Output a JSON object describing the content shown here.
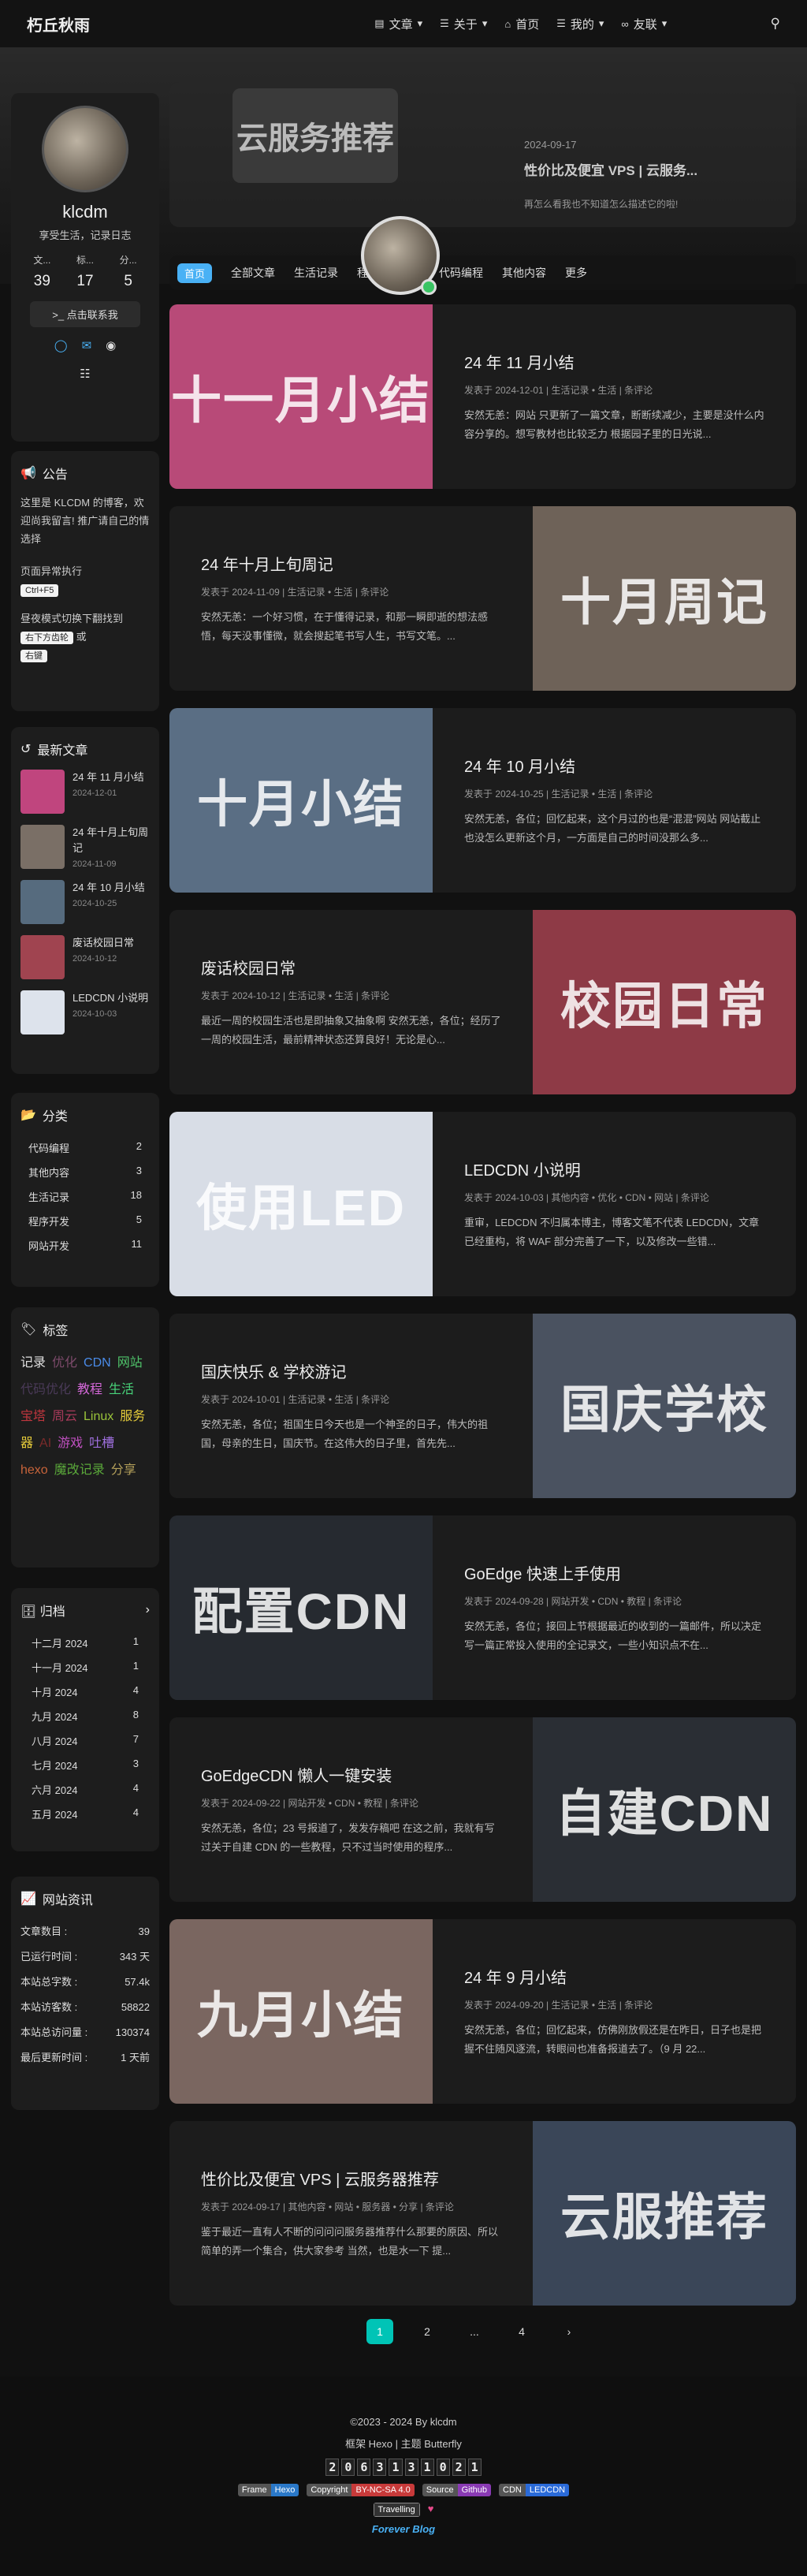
{
  "nav": {
    "brand": "朽丘秋雨",
    "menu": [
      {
        "icon": "▤",
        "label": "文章",
        "caret": true
      },
      {
        "icon": "☰",
        "label": "关于",
        "caret": true
      },
      {
        "icon": "⌂",
        "label": "首页",
        "caret": false
      },
      {
        "icon": "☰",
        "label": "我的",
        "caret": true
      },
      {
        "icon": "∞",
        "label": "友联",
        "caret": true
      }
    ],
    "search_icon": "search-icon"
  },
  "featured": {
    "thumb_text": "云服务推荐",
    "date": "2024-09-17",
    "title": "性价比及便宜 VPS | 云服务...",
    "excerpt": "再怎么看我也不知道怎么描述它的啦!"
  },
  "catbar": [
    "首页",
    "全部文章",
    "生活记录",
    "程序",
    "开发",
    "代码编程",
    "其他内容",
    "更多"
  ],
  "profile": {
    "name": "klcdm",
    "motto": "享受生活，记录日志",
    "stats": [
      {
        "k": "文...",
        "v": "39"
      },
      {
        "k": "标...",
        "v": "17"
      },
      {
        "k": "分...",
        "v": "5"
      }
    ],
    "contact": "点击联系我"
  },
  "announce": {
    "title": "公告",
    "text": "这里是 KLCDM 的博客，欢迎尚我留言! 推广请自己的情选择",
    "exec": "页面异常执行",
    "key": "Ctrl+F5",
    "tip1": "昼夜模式切换下翻找到",
    "key2": "右下方齿轮",
    "or": "或",
    "key3": "右键"
  },
  "recent": {
    "title": "最新文章",
    "items": [
      {
        "title": "24 年 11 月小结",
        "date": "2024-12-01",
        "color": "#c0457e"
      },
      {
        "title": "24 年十月上旬周记",
        "date": "2024-11-09",
        "color": "#7a6f66"
      },
      {
        "title": "24 年 10 月小结",
        "date": "2024-10-25",
        "color": "#566b7e"
      },
      {
        "title": "废话校园日常",
        "date": "2024-10-12",
        "color": "#a04450"
      },
      {
        "title": "LEDCDN 小说明",
        "date": "2024-10-03",
        "color": "#dde3ec"
      }
    ]
  },
  "categories": {
    "title": "分类",
    "items": [
      {
        "name": "代码编程",
        "count": "2"
      },
      {
        "name": "其他内容",
        "count": "3"
      },
      {
        "name": "生活记录",
        "count": "18"
      },
      {
        "name": "程序开发",
        "count": "5"
      },
      {
        "name": "网站开发",
        "count": "11"
      }
    ]
  },
  "tags": {
    "title": "标签",
    "items": [
      {
        "t": "记录",
        "c": "#e0e0e0"
      },
      {
        "t": "优化",
        "c": "#7c4a6a"
      },
      {
        "t": "CDN",
        "c": "#4a8be8"
      },
      {
        "t": "网站",
        "c": "#4fc36a"
      },
      {
        "t": "代码优化",
        "c": "#4a3a58"
      },
      {
        "t": "教程",
        "c": "#d468d8"
      },
      {
        "t": "生活",
        "c": "#48d47a"
      },
      {
        "t": "宝塔",
        "c": "#c0363e"
      },
      {
        "t": "周云",
        "c": "#a83a5a"
      },
      {
        "t": "Linux",
        "c": "#9ac43a"
      },
      {
        "t": "服务器",
        "c": "#e6cc3a"
      },
      {
        "t": "AI",
        "c": "#7a2a2a"
      },
      {
        "t": "游戏",
        "c": "#c050c0"
      },
      {
        "t": "吐槽",
        "c": "#a070e0"
      },
      {
        "t": "hexo",
        "c": "#c8643a"
      },
      {
        "t": "魔改记录",
        "c": "#5aa83a"
      },
      {
        "t": "分享",
        "c": "#b4a05a"
      }
    ]
  },
  "archive": {
    "title": "归档",
    "items": [
      {
        "m": "十二月 2024",
        "n": "1"
      },
      {
        "m": "十一月 2024",
        "n": "1"
      },
      {
        "m": "十月 2024",
        "n": "4"
      },
      {
        "m": "九月 2024",
        "n": "8"
      },
      {
        "m": "八月 2024",
        "n": "7"
      },
      {
        "m": "七月 2024",
        "n": "3"
      },
      {
        "m": "六月 2024",
        "n": "4"
      },
      {
        "m": "五月 2024",
        "n": "4"
      }
    ]
  },
  "siteinfo": {
    "title": "网站资讯",
    "rows": [
      {
        "k": "文章数目 :",
        "v": "39"
      },
      {
        "k": "已运行时间 :",
        "v": "343 天"
      },
      {
        "k": "本站总字数 :",
        "v": "57.4k"
      },
      {
        "k": "本站访客数 :",
        "v": "58822"
      },
      {
        "k": "本站总访问量 :",
        "v": "130374"
      },
      {
        "k": "最后更新时间 :",
        "v": "1 天前"
      }
    ]
  },
  "posts": [
    {
      "title": "24 年 11 月小结",
      "meta": "发表于 2024-12-01 | 生活记录 • 生活 | 条评论",
      "excerpt": "安然无恙：网站 只更新了一篇文章，断断续减少，主要是没什么内容分享的。想写教材也比较乏力 根据园子里的日光说...",
      "thumb": "十一月小结",
      "color": "#b84a78",
      "side": "left"
    },
    {
      "title": "24 年十月上旬周记",
      "meta": "发表于 2024-11-09 | 生活记录 • 生活 | 条评论",
      "excerpt": "安然无恙：一个好习惯，在于懂得记录，和那一瞬即逝的想法感悟，每天没事懂微，就会搜起笔书写人生，书写文笔。...",
      "thumb": "十月周记",
      "color": "#6e6258",
      "side": "right"
    },
    {
      "title": "24 年 10 月小结",
      "meta": "发表于 2024-10-25 | 生活记录 • 生活 | 条评论",
      "excerpt": "安然无恙，各位；回忆起来，这个月过的也是“混混”网站 网站截止也没怎么更新这个月，一方面是自己的时间没那么多...",
      "thumb": "十月小结",
      "color": "#5a6e84",
      "side": "left"
    },
    {
      "title": "废话校园日常",
      "meta": "发表于 2024-10-12 | 生活记录 • 生活 | 条评论",
      "excerpt": "最近一周的校园生活也是即抽象又抽象啊 安然无恙，各位；经历了一周的校园生活，最前精神状态还算良好！无论是心...",
      "thumb": "校园日常",
      "color": "#8e3a46",
      "side": "right"
    },
    {
      "title": "LEDCDN 小说明",
      "meta": "发表于 2024-10-03 | 其他内容 • 优化 • CDN • 网站 | 条评论",
      "excerpt": "重审，LEDCDN 不归属本博主，博客文笔不代表 LEDCDN，文章已经重构，将 WAF 部分完善了一下，以及修改一些错...",
      "thumb": "使用LED",
      "color": "#d8dde6",
      "side": "left"
    },
    {
      "title": "国庆快乐 & 学校游记",
      "meta": "发表于 2024-10-01 | 生活记录 • 生活 | 条评论",
      "excerpt": "安然无恙，各位；祖国生日今天也是一个神圣的日子，伟大的祖国，母亲的生日，国庆节。在这伟大的日子里，首先先...",
      "thumb": "国庆学校",
      "color": "#4a5260",
      "side": "right"
    },
    {
      "title": "GoEdge 快速上手使用",
      "meta": "发表于 2024-09-28 | 网站开发 • CDN • 教程 | 条评论",
      "excerpt": "安然无恙，各位；接回上节根据最近的收到的一篇邮件，所以决定写一篇正常投入使用的全记录文，一些小知识点不在...",
      "thumb": "配置CDN",
      "color": "#262a30",
      "side": "left"
    },
    {
      "title": "GoEdgeCDN 懒人一键安装",
      "meta": "发表于 2024-09-22 | 网站开发 • CDN • 教程 | 条评论",
      "excerpt": "安然无恙，各位；23 号报道了，发发存稿吧 在这之前，我就有写过关于自建 CDN 的一些教程，只不过当时使用的程序...",
      "thumb": "自建CDN",
      "color": "#2a2e34",
      "side": "right"
    },
    {
      "title": "24 年 9 月小结",
      "meta": "发表于 2024-09-20 | 生活记录 • 生活 | 条评论",
      "excerpt": "安然无恙，各位；回忆起来，仿佛刚放假还是在昨日，日子也是把握不住随风逐流，转眼间也准备报道去了。（9 月 22...",
      "thumb": "九月小结",
      "color": "#7a6660",
      "side": "left"
    },
    {
      "title": "性价比及便宜 VPS | 云服务器推荐",
      "meta": "发表于 2024-09-17 | 其他内容 • 网站 • 服务器 • 分享 | 条评论",
      "excerpt": "鉴于最近一直有人不断的问问问服务器推荐什么那要的原因、所以简单的弄一个集合，供大家参考 当然，也是水一下 提...",
      "thumb": "云服推荐",
      "color": "#3a4658",
      "side": "right"
    }
  ],
  "pager": [
    "1",
    "2",
    "...",
    "4",
    "›"
  ],
  "footer": {
    "copy": "©2023 - 2024 By klcdm",
    "frame": "框架 Hexo | 主题 Butterfly",
    "counter": [
      "2",
      "0",
      "6",
      "3",
      "1",
      "3",
      "1",
      "0",
      "2",
      "1"
    ],
    "badges": [
      {
        "l": "Frame",
        "r": "Hexo",
        "c": "#2a78c8"
      },
      {
        "l": "Copyright",
        "r": "BY-NC-SA 4.0",
        "c": "#c83a3a"
      },
      {
        "l": "Source",
        "r": "Github",
        "c": "#8a3ab4"
      },
      {
        "l": "CDN",
        "r": "LEDCDN",
        "c": "#2a6ad8"
      }
    ],
    "travelling": "Travelling",
    "forever": "Forever Blog"
  }
}
